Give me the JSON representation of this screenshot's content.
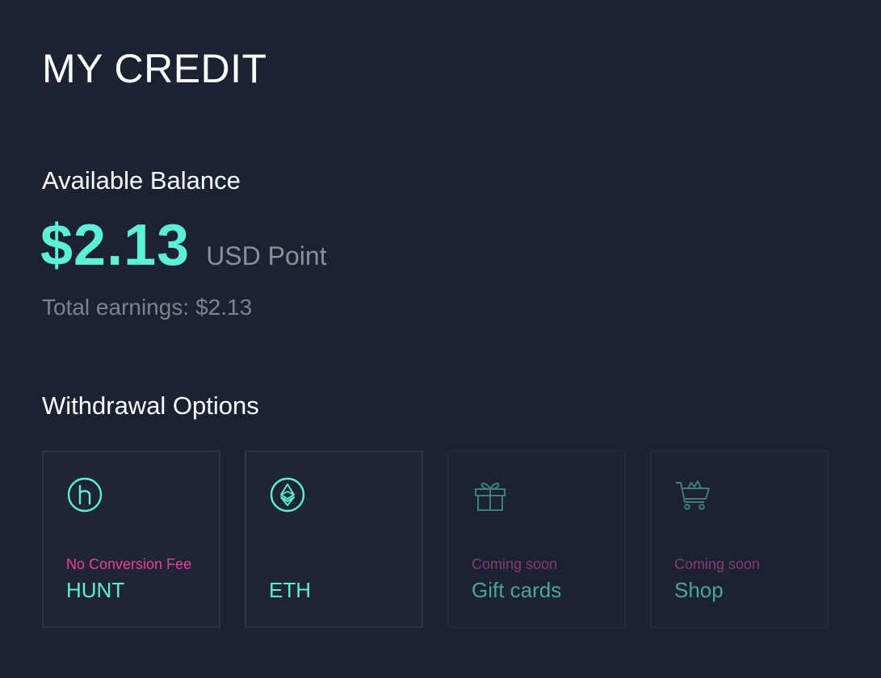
{
  "page": {
    "title": "MY CREDIT"
  },
  "balance": {
    "heading": "Available Balance",
    "amount": "$2.13",
    "unit": "USD Point",
    "total_label": "Total earnings:",
    "total_value": "$2.13"
  },
  "withdrawal": {
    "heading": "Withdrawal Options",
    "options": [
      {
        "name": "HUNT",
        "tag": "No Conversion Fee",
        "icon": "hunt-icon",
        "available": true
      },
      {
        "name": "ETH",
        "tag": "",
        "icon": "ethereum-icon",
        "available": true
      },
      {
        "name": "Gift cards",
        "tag": "Coming soon",
        "icon": "gift-icon",
        "available": false
      },
      {
        "name": "Shop",
        "tag": "Coming soon",
        "icon": "shopping-cart-icon",
        "available": false
      }
    ]
  },
  "colors": {
    "background": "#1b2231",
    "accent": "#5cf1d7",
    "accent_dim": "#4ea597",
    "tag_pink": "#ea3ea0",
    "tag_pink_dim": "#8a3873",
    "muted_text": "#8a909a"
  }
}
